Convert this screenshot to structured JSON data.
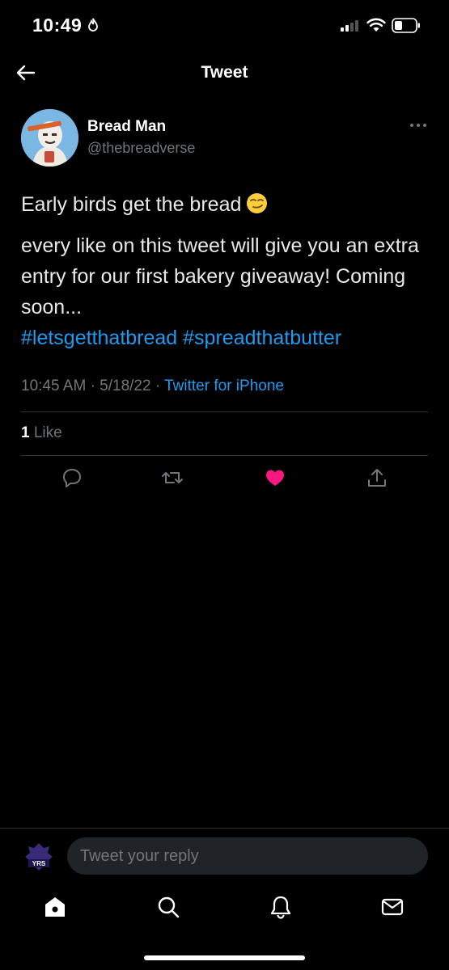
{
  "status_bar": {
    "time": "10:49",
    "icons": [
      "focus-flame-icon",
      "signal-icon",
      "wifi-icon",
      "battery-icon"
    ]
  },
  "header": {
    "title": "Tweet",
    "back_icon": "back-arrow-icon"
  },
  "tweet": {
    "author": {
      "name": "Bread Man",
      "handle": "@thebreadverse"
    },
    "line1": "Early birds get the bread",
    "line1_emoji": "smirking-face-emoji",
    "body": "every like on this tweet will give you an extra entry for our first bakery giveaway! Coming soon...",
    "hashtags": [
      "#letsgetthatbread",
      "#spreadthatbutter"
    ],
    "time": "10:45 AM",
    "date": "5/18/22",
    "source": "Twitter for iPhone",
    "likes_count": "1",
    "likes_label": "Like",
    "liked": true
  },
  "actions": [
    "reply-icon",
    "retweet-icon",
    "like-icon",
    "share-icon"
  ],
  "reply": {
    "placeholder": "Tweet your reply"
  },
  "tabs": [
    "home-icon",
    "search-icon",
    "notifications-icon",
    "messages-icon"
  ],
  "colors": {
    "background": "#000000",
    "accent": "#1d9bf0",
    "like": "#f91880",
    "muted": "#71767b",
    "divider": "#2f3336"
  }
}
